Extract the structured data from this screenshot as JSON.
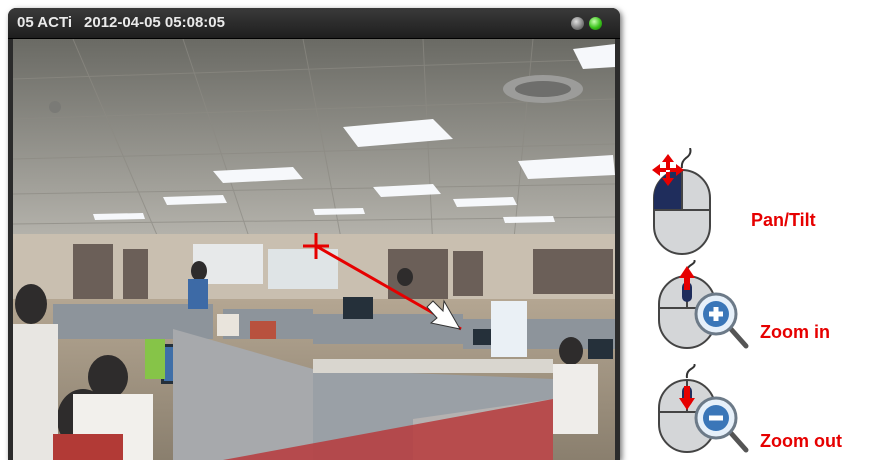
{
  "viewer": {
    "camera_title": "05 ACTi",
    "timestamp": "2012-04-05 05:08:05"
  },
  "legend": {
    "pan_tilt": "Pan/Tilt",
    "zoom_in": "Zoom in",
    "zoom_out": "Zoom out"
  },
  "colors": {
    "accent": "#e60000",
    "status_green": "#39c21a",
    "status_gray": "#9a9a9a"
  },
  "icons": [
    "mouse-pan-icon",
    "mouse-zoom-in-icon",
    "mouse-zoom-out-icon",
    "pan-cursor-icon",
    "drag-arrow-icon"
  ]
}
